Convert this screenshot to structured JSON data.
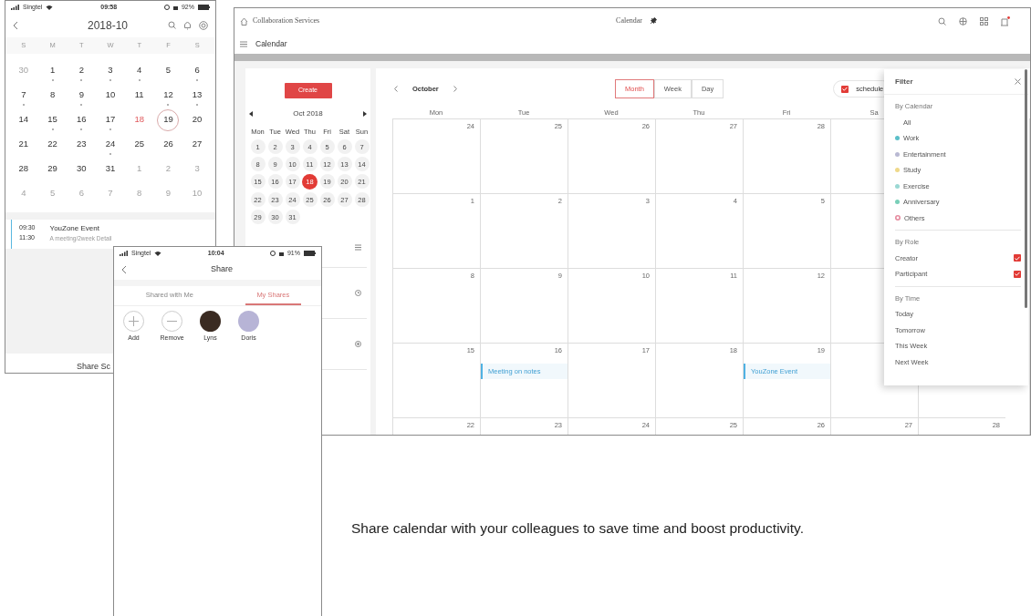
{
  "phone_calendar": {
    "status": {
      "carrier": "Singtel",
      "time": "09:58",
      "battery": "92%"
    },
    "title": "2018-10",
    "weekdays": [
      "S",
      "M",
      "T",
      "W",
      "T",
      "F",
      "S"
    ],
    "weeks": [
      [
        {
          "day": "30",
          "muted": true,
          "dot": false,
          "today": false,
          "selected": false
        },
        {
          "day": "1",
          "muted": false,
          "dot": true,
          "today": false,
          "selected": false
        },
        {
          "day": "2",
          "muted": false,
          "dot": true,
          "today": false,
          "selected": false
        },
        {
          "day": "3",
          "muted": false,
          "dot": true,
          "today": false,
          "selected": false
        },
        {
          "day": "4",
          "muted": false,
          "dot": true,
          "today": false,
          "selected": false
        },
        {
          "day": "5",
          "muted": false,
          "dot": false,
          "today": false,
          "selected": false
        },
        {
          "day": "6",
          "muted": false,
          "dot": true,
          "today": false,
          "selected": false
        }
      ],
      [
        {
          "day": "7",
          "muted": false,
          "dot": true,
          "today": false,
          "selected": false
        },
        {
          "day": "8",
          "muted": false,
          "dot": false,
          "today": false,
          "selected": false
        },
        {
          "day": "9",
          "muted": false,
          "dot": true,
          "today": false,
          "selected": false
        },
        {
          "day": "10",
          "muted": false,
          "dot": false,
          "today": false,
          "selected": false
        },
        {
          "day": "11",
          "muted": false,
          "dot": false,
          "today": false,
          "selected": false
        },
        {
          "day": "12",
          "muted": false,
          "dot": true,
          "today": false,
          "selected": false
        },
        {
          "day": "13",
          "muted": false,
          "dot": true,
          "today": false,
          "selected": false
        }
      ],
      [
        {
          "day": "14",
          "muted": false,
          "dot": false,
          "today": false,
          "selected": false
        },
        {
          "day": "15",
          "muted": false,
          "dot": true,
          "today": false,
          "selected": false
        },
        {
          "day": "16",
          "muted": false,
          "dot": true,
          "today": false,
          "selected": false
        },
        {
          "day": "17",
          "muted": false,
          "dot": true,
          "today": false,
          "selected": false
        },
        {
          "day": "18",
          "muted": false,
          "dot": false,
          "today": true,
          "selected": false
        },
        {
          "day": "19",
          "muted": false,
          "dot": false,
          "today": false,
          "selected": true
        },
        {
          "day": "20",
          "muted": false,
          "dot": false,
          "today": false,
          "selected": false
        }
      ],
      [
        {
          "day": "21",
          "muted": false,
          "dot": false,
          "today": false,
          "selected": false
        },
        {
          "day": "22",
          "muted": false,
          "dot": false,
          "today": false,
          "selected": false
        },
        {
          "day": "23",
          "muted": false,
          "dot": false,
          "today": false,
          "selected": false
        },
        {
          "day": "24",
          "muted": false,
          "dot": true,
          "today": false,
          "selected": false
        },
        {
          "day": "25",
          "muted": false,
          "dot": false,
          "today": false,
          "selected": false
        },
        {
          "day": "26",
          "muted": false,
          "dot": false,
          "today": false,
          "selected": false
        },
        {
          "day": "27",
          "muted": false,
          "dot": false,
          "today": false,
          "selected": false
        }
      ],
      [
        {
          "day": "28",
          "muted": false,
          "dot": false,
          "today": false,
          "selected": false
        },
        {
          "day": "29",
          "muted": false,
          "dot": false,
          "today": false,
          "selected": false
        },
        {
          "day": "30",
          "muted": false,
          "dot": false,
          "today": false,
          "selected": false
        },
        {
          "day": "31",
          "muted": false,
          "dot": false,
          "today": false,
          "selected": false
        },
        {
          "day": "1",
          "muted": true,
          "dot": false,
          "today": false,
          "selected": false
        },
        {
          "day": "2",
          "muted": true,
          "dot": false,
          "today": false,
          "selected": false
        },
        {
          "day": "3",
          "muted": true,
          "dot": false,
          "today": false,
          "selected": false
        }
      ],
      [
        {
          "day": "4",
          "muted": true,
          "dot": false,
          "today": false,
          "selected": false
        },
        {
          "day": "5",
          "muted": true,
          "dot": false,
          "today": false,
          "selected": false
        },
        {
          "day": "6",
          "muted": true,
          "dot": false,
          "today": false,
          "selected": false
        },
        {
          "day": "7",
          "muted": true,
          "dot": false,
          "today": false,
          "selected": false
        },
        {
          "day": "8",
          "muted": true,
          "dot": false,
          "today": false,
          "selected": false
        },
        {
          "day": "9",
          "muted": true,
          "dot": false,
          "today": false,
          "selected": false
        },
        {
          "day": "10",
          "muted": true,
          "dot": false,
          "today": false,
          "selected": false
        }
      ]
    ],
    "event": {
      "start": "09:30",
      "end": "11:30",
      "title": "YouZone Event",
      "detail": "A meeting/2week Detail"
    },
    "footer": "Share Sc"
  },
  "desktop": {
    "breadcrumb": "Collaboration Services",
    "title": "Calendar",
    "app_title": "Calendar",
    "create": "Create",
    "mini_calendar": {
      "title": "Oct 2018",
      "weekdays": [
        "Mon",
        "Tue",
        "Wed",
        "Thu",
        "Fri",
        "Sat",
        "Sun"
      ],
      "days": [
        {
          "day": "1",
          "selected": false
        },
        {
          "day": "2",
          "selected": false
        },
        {
          "day": "3",
          "selected": false
        },
        {
          "day": "4",
          "selected": false
        },
        {
          "day": "5",
          "selected": false
        },
        {
          "day": "6",
          "selected": false
        },
        {
          "day": "7",
          "selected": false
        },
        {
          "day": "8",
          "selected": false
        },
        {
          "day": "9",
          "selected": false
        },
        {
          "day": "10",
          "selected": false
        },
        {
          "day": "11",
          "selected": false
        },
        {
          "day": "12",
          "selected": false
        },
        {
          "day": "13",
          "selected": false
        },
        {
          "day": "14",
          "selected": false
        },
        {
          "day": "15",
          "selected": false
        },
        {
          "day": "16",
          "selected": false
        },
        {
          "day": "17",
          "selected": false
        },
        {
          "day": "18",
          "selected": true
        },
        {
          "day": "19",
          "selected": false
        },
        {
          "day": "20",
          "selected": false
        },
        {
          "day": "21",
          "selected": false
        },
        {
          "day": "22",
          "selected": false
        },
        {
          "day": "23",
          "selected": false
        },
        {
          "day": "24",
          "selected": false
        },
        {
          "day": "25",
          "selected": false
        },
        {
          "day": "26",
          "selected": false
        },
        {
          "day": "27",
          "selected": false
        },
        {
          "day": "28",
          "selected": false
        },
        {
          "day": "29",
          "selected": false
        },
        {
          "day": "30",
          "selected": false
        },
        {
          "day": "31",
          "selected": false
        }
      ]
    },
    "month": "October",
    "views": [
      {
        "label": "Month",
        "selected": true
      },
      {
        "label": "Week",
        "selected": false
      },
      {
        "label": "Day",
        "selected": false
      }
    ],
    "toggles": [
      {
        "label": "schedule",
        "checked": true
      }
    ],
    "weekdays": [
      "Mon",
      "Tue",
      "Wed",
      "Thu",
      "Fri",
      "Sa"
    ],
    "weeks": [
      [
        {
          "day": "24"
        },
        {
          "day": "25"
        },
        {
          "day": "26"
        },
        {
          "day": "27"
        },
        {
          "day": "28"
        }
      ],
      [
        {
          "day": "1"
        },
        {
          "day": "2"
        },
        {
          "day": "3"
        },
        {
          "day": "4"
        },
        {
          "day": "5"
        }
      ],
      [
        {
          "day": "8"
        },
        {
          "day": "9"
        },
        {
          "day": "10"
        },
        {
          "day": "11"
        },
        {
          "day": "12"
        }
      ],
      [
        {
          "day": "15"
        },
        {
          "day": "16",
          "events": [
            "Meeting on notes"
          ]
        },
        {
          "day": "17"
        },
        {
          "day": "18"
        },
        {
          "day": "19",
          "events": [
            "YouZone Event"
          ]
        }
      ],
      [
        {
          "day": "22"
        },
        {
          "day": "23"
        },
        {
          "day": "24"
        },
        {
          "day": "25"
        },
        {
          "day": "26"
        },
        {
          "day": "27"
        },
        {
          "day": "28"
        }
      ]
    ],
    "filter": {
      "title": "Filter",
      "sections": [
        {
          "title": "By Calendar",
          "items": [
            {
              "kind": "plain",
              "label": "All"
            },
            {
              "kind": "dot",
              "label": "Work",
              "color": "#5bbfc9"
            },
            {
              "kind": "dot",
              "label": "Entertainment",
              "color": "#b9b9d3"
            },
            {
              "kind": "dot",
              "label": "Study",
              "color": "#efd98a"
            },
            {
              "kind": "dot",
              "label": "Exercise",
              "color": "#9ad8d3"
            },
            {
              "kind": "dot",
              "label": "Anniversary",
              "color": "#79cfb8"
            },
            {
              "kind": "ring",
              "label": "Others",
              "color": "#e58a9e"
            }
          ]
        },
        {
          "title": "By Role",
          "items": [
            {
              "kind": "check",
              "label": "Creator",
              "checked": true
            },
            {
              "kind": "check",
              "label": "Participant",
              "checked": true
            }
          ]
        },
        {
          "title": "By Time",
          "items": [
            {
              "kind": "plain",
              "label": "Today"
            },
            {
              "kind": "plain",
              "label": "Tomorrow"
            },
            {
              "kind": "plain",
              "label": "This Week"
            },
            {
              "kind": "plain",
              "label": "Next Week"
            }
          ]
        }
      ]
    }
  },
  "phone_share": {
    "status": {
      "carrier": "Singtel",
      "time": "10:04",
      "battery": "91%"
    },
    "title": "Share",
    "tabs": [
      {
        "label": "Shared with Me",
        "selected": false
      },
      {
        "label": "My Shares",
        "selected": true
      }
    ],
    "people": [
      {
        "kind": "add",
        "label": "Add"
      },
      {
        "kind": "remove",
        "label": "Remove"
      },
      {
        "kind": "photo",
        "label": "Lyns"
      },
      {
        "kind": "photo",
        "label": "Doris"
      }
    ]
  },
  "caption": "Share calendar with your colleagues to save time and boost productivity."
}
